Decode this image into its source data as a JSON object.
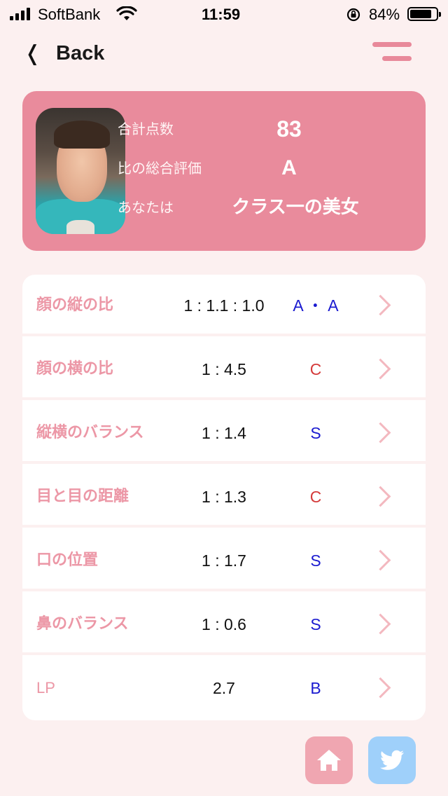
{
  "status_bar": {
    "carrier": "SoftBank",
    "time": "11:59",
    "battery": "84%",
    "battery_level": 0.84
  },
  "nav": {
    "back_label": "Back",
    "back_icon": "chevron-left-icon",
    "menu_icon": "menu-icon"
  },
  "summary": {
    "total_label": "合計点数",
    "total_value": "83",
    "rating_label": "比の総合評価",
    "rating_value": "A",
    "you_label": "あなたは",
    "you_value": "クラス一の美女"
  },
  "items": [
    {
      "label": "顔の縦の比",
      "ratio": "1 : 1.1 : 1.0",
      "grade": "A ・ A",
      "grade_color": "#1a1ad0"
    },
    {
      "label": "顔の横の比",
      "ratio": "1 : 4.5",
      "grade": "C",
      "grade_color": "#d43a3a"
    },
    {
      "label": "縦横のバランス",
      "ratio": "1 : 1.4",
      "grade": "S",
      "grade_color": "#1a1ad0"
    },
    {
      "label": "目と目の距離",
      "ratio": "1 : 1.3",
      "grade": "C",
      "grade_color": "#d43a3a"
    },
    {
      "label": "口の位置",
      "ratio": "1 : 1.7",
      "grade": "S",
      "grade_color": "#1a1ad0"
    },
    {
      "label": "鼻のバランス",
      "ratio": "1 : 0.6",
      "grade": "S",
      "grade_color": "#1a1ad0"
    },
    {
      "label": "LP",
      "ratio": "2.7",
      "grade": "B",
      "grade_color": "#1a1ad0"
    }
  ],
  "buttons": {
    "home_icon": "home-icon",
    "twitter_icon": "twitter-icon"
  },
  "colors": {
    "background": "#fcf0f0",
    "accent": "#e98b9c",
    "label": "#ec97a6",
    "chevron": "#f3b8bf",
    "home_button": "#f0a6b1",
    "twitter_button": "#9fd0fa"
  }
}
